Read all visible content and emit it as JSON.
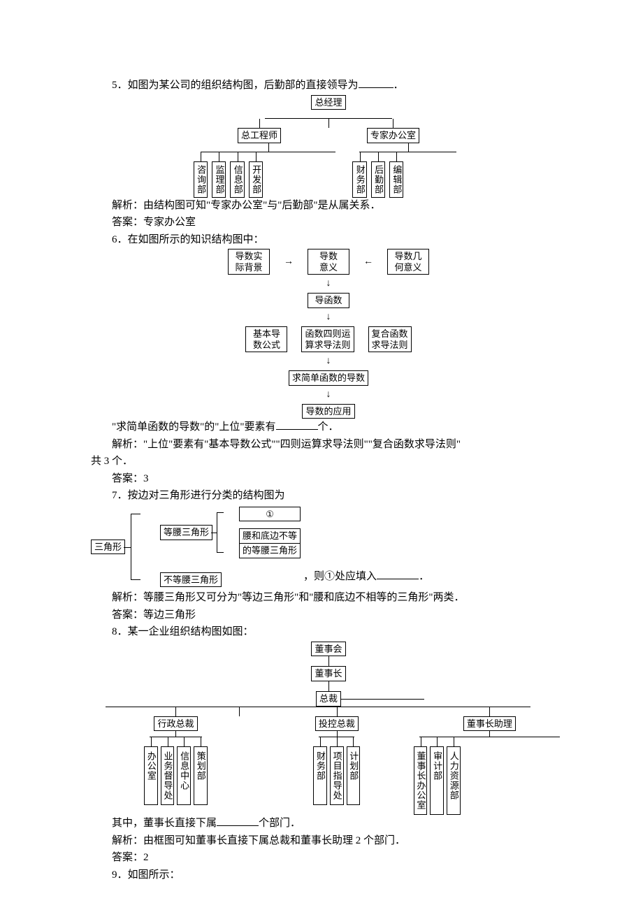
{
  "q5": {
    "question": "5．如图为某公司的组织结构图，后勤部的直接领导为",
    "period": "．",
    "analysis_label": "解析：",
    "analysis": "由结构图可知\"专家办公室\"与\"后勤部\"是从属关系．",
    "answer_label": "答案：",
    "answer": "专家办公室",
    "chart": {
      "top": "总经理",
      "l2a": "总工程师",
      "l2b": "专家办公室",
      "eng": [
        "咨询部",
        "监理部",
        "信息部",
        "开发部"
      ],
      "exp": [
        "财务部",
        "后勤部",
        "编辑部"
      ]
    }
  },
  "q6": {
    "question": "6．在如图所示的知识结构图中：",
    "chart": {
      "r1a": "导数实\n际背景",
      "r1b": "导数\n意义",
      "r1c": "导数几\n何意义",
      "r2": "导函数",
      "r3a": "基本导\n数公式",
      "r3b": "函数四则运\n算求导法则",
      "r3c": "复合函数\n求导法则",
      "r4": "求简单函数的导数",
      "r5": "导数的应用"
    },
    "followup_a": "\"求简单函数的导数\"的\"上位\"要素有",
    "followup_b": "个．",
    "analysis_label": "解析：",
    "analysis": "\"上位\"要素有\"基本导数公式\"\"四则运算求导法则\"\"复合函数求导法则\"",
    "analysis2": "共 3 个．",
    "answer_label": "答案：",
    "answer": "3"
  },
  "q7": {
    "question": "7．按边对三角形进行分类的结构图为",
    "chart": {
      "root": "三角形",
      "b1": "等腰三角形",
      "b2": "不等腰三角形",
      "c1": "①",
      "c2a": "腰和底边不等",
      "c2b": "的等腰三角形"
    },
    "after": "，则①处应填入",
    "period": "．",
    "analysis_label": "解析：",
    "analysis": "等腰三角形又可分为\"等边三角形\"和\"腰和底边不相等的三角形\"两类．",
    "answer_label": "答案：",
    "answer": "等边三角形"
  },
  "q8": {
    "question": "8．某一企业组织结构图如图：",
    "chart": {
      "a": "董事会",
      "b": "董事长",
      "c": "总裁",
      "d1": "行政总裁",
      "d2": "投控总裁",
      "d3": "董事长助理",
      "g1": [
        "办公室",
        "业务督导处",
        "信息中心",
        "策划部"
      ],
      "g2": [
        "财务部",
        "项目指导处",
        "计划部"
      ],
      "g3": [
        "董事长办公室",
        "审计部",
        "人力资源部"
      ]
    },
    "followup_a": "其中，董事长直接下属",
    "followup_b": "个部门．",
    "analysis_label": "解析：",
    "analysis": "由框图可知董事长直接下属总裁和董事长助理 2 个部门．",
    "answer_label": "答案：",
    "answer": "2"
  },
  "q9": {
    "question": "9．如图所示："
  }
}
